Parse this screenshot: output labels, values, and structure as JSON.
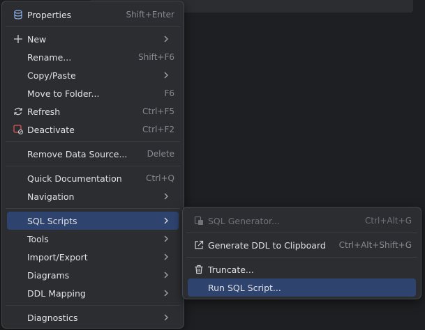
{
  "main_menu": {
    "properties": {
      "label": "Properties",
      "shortcut": "Shift+Enter"
    },
    "new": {
      "label": "New"
    },
    "rename": {
      "label": "Rename...",
      "shortcut": "Shift+F6"
    },
    "copy_paste": {
      "label": "Copy/Paste"
    },
    "move_to_folder": {
      "label": "Move to Folder...",
      "shortcut": "F6"
    },
    "refresh": {
      "label": "Refresh",
      "shortcut": "Ctrl+F5"
    },
    "deactivate": {
      "label": "Deactivate",
      "shortcut": "Ctrl+F2"
    },
    "remove_data_source": {
      "label": "Remove Data Source...",
      "shortcut": "Delete"
    },
    "quick_documentation": {
      "label": "Quick Documentation",
      "shortcut": "Ctrl+Q"
    },
    "navigation": {
      "label": "Navigation"
    },
    "sql_scripts": {
      "label": "SQL Scripts"
    },
    "tools": {
      "label": "Tools"
    },
    "import_export": {
      "label": "Import/Export"
    },
    "diagrams": {
      "label": "Diagrams"
    },
    "ddl_mapping": {
      "label": "DDL Mapping"
    },
    "diagnostics": {
      "label": "Diagnostics"
    }
  },
  "sub_menu": {
    "sql_generator": {
      "label": "SQL Generator...",
      "shortcut": "Ctrl+Alt+G"
    },
    "generate_ddl": {
      "label": "Generate DDL to Clipboard",
      "shortcut": "Ctrl+Alt+Shift+G"
    },
    "truncate": {
      "label": "Truncate..."
    },
    "run_sql_script": {
      "label": "Run SQL Script..."
    }
  },
  "colors": {
    "menu_bg": "#2b2d30",
    "selection": "#2e436e",
    "text": "#dfe1e5",
    "shortcut": "#868a91",
    "disabled": "#6f737a"
  },
  "icons": [
    "database-properties-icon",
    "plus-icon",
    "refresh-icon",
    "deactivate-icon",
    "sql-generator-icon",
    "export-arrow-icon",
    "trash-icon",
    "chevron-right-icon"
  ]
}
